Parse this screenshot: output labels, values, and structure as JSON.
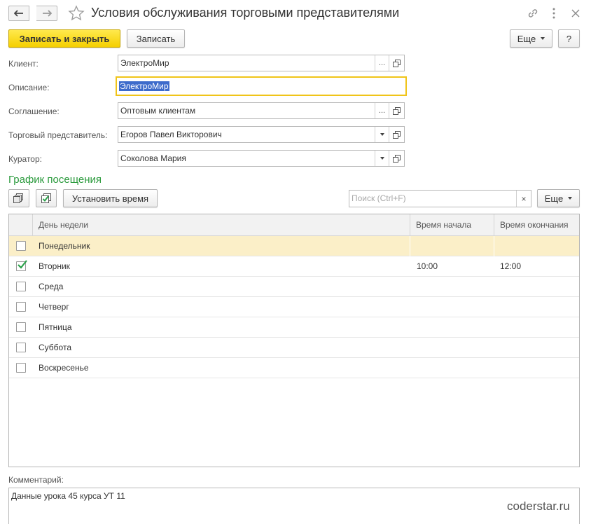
{
  "window": {
    "title": "Условия обслуживания торговыми представителями"
  },
  "toolbar": {
    "save_close_label": "Записать и закрыть",
    "save_label": "Записать",
    "more_label": "Еще",
    "help_label": "?"
  },
  "form": {
    "client_label": "Клиент:",
    "client_value": "ЭлектроМир",
    "description_label": "Описание:",
    "description_value": "ЭлектроМир",
    "agreement_label": "Соглашение:",
    "agreement_value": "Оптовым клиентам",
    "agent_label": "Торговый представитель:",
    "agent_value": "Егоров Павел Викторович",
    "curator_label": "Куратор:",
    "curator_value": "Соколова Мария",
    "select_button": "...",
    "clear_button": "×"
  },
  "schedule": {
    "section_title": "График посещения",
    "set_time_label": "Установить время",
    "search_placeholder": "Поиск (Ctrl+F)",
    "more_label": "Еще",
    "columns": [
      "День недели",
      "Время начала",
      "Время окончания"
    ],
    "rows": [
      {
        "checked": false,
        "day": "Понедельник",
        "start": "",
        "end": ""
      },
      {
        "checked": true,
        "day": "Вторник",
        "start": "10:00",
        "end": "12:00"
      },
      {
        "checked": false,
        "day": "Среда",
        "start": "",
        "end": ""
      },
      {
        "checked": false,
        "day": "Четверг",
        "start": "",
        "end": ""
      },
      {
        "checked": false,
        "day": "Пятница",
        "start": "",
        "end": ""
      },
      {
        "checked": false,
        "day": "Суббота",
        "start": "",
        "end": ""
      },
      {
        "checked": false,
        "day": "Воскресенье",
        "start": "",
        "end": ""
      }
    ]
  },
  "comment": {
    "label": "Комментарий:",
    "value": "Данные урока 45 курса УТ 11"
  },
  "watermark": "coderstar.ru",
  "colors": {
    "accent_yellow": "#f5cf00",
    "section_green": "#2a9a3c",
    "selected_row": "#fbefc8",
    "focus_border": "#f0c419",
    "check_green": "#2aa14a"
  }
}
